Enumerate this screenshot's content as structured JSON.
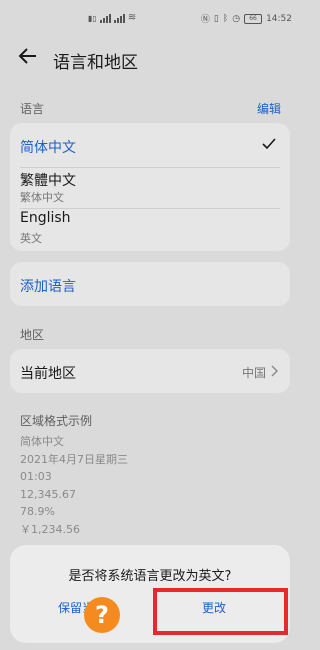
{
  "status": {
    "time": "14:52",
    "battery": "66"
  },
  "header": {
    "title": "语言和地区"
  },
  "language_section": {
    "label": "语言",
    "edit_label": "编辑",
    "items": [
      {
        "name": "简体中文",
        "sub": ""
      },
      {
        "name": "繁體中文",
        "sub": "繁体中文"
      },
      {
        "name": "English",
        "sub": "英文"
      }
    ],
    "add_label": "添加语言"
  },
  "region_section": {
    "label": "地区",
    "current_label": "当前地区",
    "current_value": "中国"
  },
  "format_section": {
    "label": "区域格式示例",
    "examples": [
      "简体中文",
      "2021年4月7日星期三",
      "01:03",
      "12,345.67",
      "78.9%",
      "￥1,234.56"
    ]
  },
  "dialog": {
    "question": "是否将系统语言更改为英文?",
    "keep_label": "保留当前",
    "change_label": "更改"
  },
  "colors": {
    "accent": "#1f5fc8",
    "highlight": "#e42b2b",
    "watermark": "#f58a1f"
  }
}
